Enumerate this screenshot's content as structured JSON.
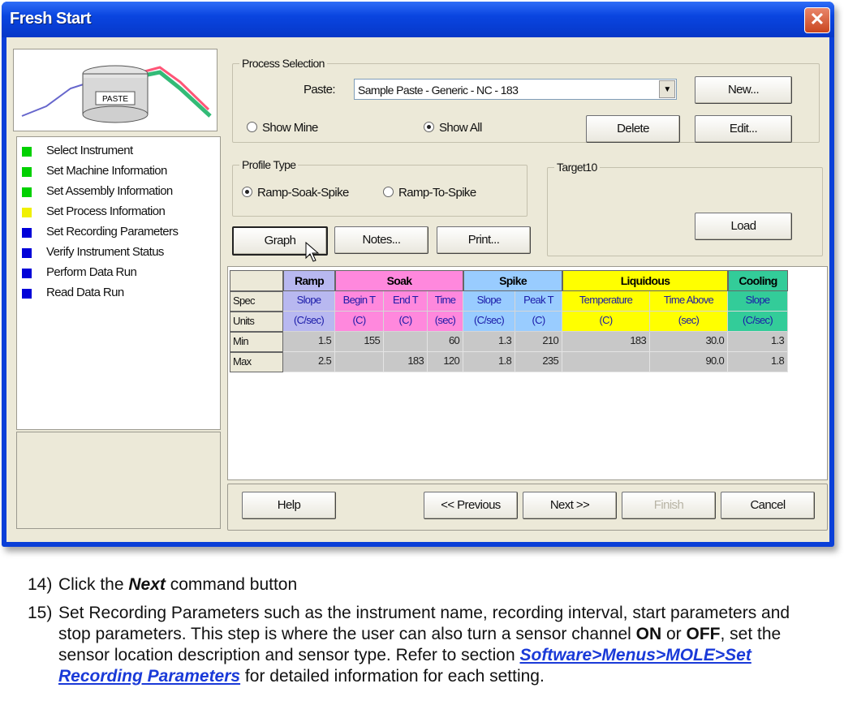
{
  "window": {
    "title": "Fresh Start",
    "close": "✕"
  },
  "image": {
    "jar_label": "PASTE"
  },
  "steps": [
    {
      "label": "Select Instrument",
      "color": "#00d000"
    },
    {
      "label": "Set Machine Information",
      "color": "#00d000"
    },
    {
      "label": "Set Assembly Information",
      "color": "#00d000"
    },
    {
      "label": "Set Process Information",
      "color": "#f0f000"
    },
    {
      "label": "Set Recording Parameters",
      "color": "#0000d8"
    },
    {
      "label": "Verify Instrument Status",
      "color": "#0000d8"
    },
    {
      "label": "Perform Data Run",
      "color": "#0000d8"
    },
    {
      "label": "Read Data Run",
      "color": "#0000d8"
    }
  ],
  "process_selection": {
    "label": "Process Selection",
    "paste_label": "Paste:",
    "paste_value": "Sample Paste - Generic - NC - 183",
    "new_button": "New...",
    "show_mine": "Show Mine",
    "show_all": "Show All",
    "delete_button": "Delete",
    "edit_button": "Edit..."
  },
  "profile_type": {
    "label": "Profile Type",
    "option1": "Ramp-Soak-Spike",
    "option2": "Ramp-To-Spike"
  },
  "target": {
    "label": "Target10",
    "load_button": "Load"
  },
  "buttons": {
    "graph": "Graph",
    "notes": "Notes...",
    "print": "Print..."
  },
  "table": {
    "groups": [
      {
        "label": "Ramp",
        "color": "#b8b8f0"
      },
      {
        "label": "Soak",
        "color": "#ff88dd"
      },
      {
        "label": "Spike",
        "color": "#99ccff"
      },
      {
        "label": "Liquidous",
        "color": "#ffff00"
      },
      {
        "label": "Cooling",
        "color": "#33cc99"
      }
    ],
    "row_labels": [
      "Spec",
      "Units",
      "Min",
      "Max"
    ],
    "spec": [
      "Slope",
      "Begin T",
      "End T",
      "Time",
      "Slope",
      "Peak T",
      "Temperature",
      "Time Above",
      "Slope"
    ],
    "units": [
      "(C/sec)",
      "(C)",
      "(C)",
      "(sec)",
      "(C/sec)",
      "(C)",
      "(C)",
      "(sec)",
      "(C/sec)"
    ],
    "min": [
      "1.5",
      "155",
      "",
      "60",
      "1.3",
      "210",
      "183",
      "30.0",
      "1.3"
    ],
    "max": [
      "2.5",
      "",
      "183",
      "120",
      "1.8",
      "235",
      "",
      "90.0",
      "1.8"
    ]
  },
  "footer": {
    "help": "Help",
    "previous": "<< Previous",
    "next": "Next >>",
    "finish": "Finish",
    "cancel": "Cancel"
  },
  "instructions": {
    "i14_num": "14)",
    "i14_pre": "Click the ",
    "i14_bold": "Next",
    "i14_post": " command button",
    "i15_num": "15)",
    "i15_a": "Set Recording Parameters such as the instrument name, recording interval, start parameters and stop parameters. This step is where the user can also turn a sensor channel ",
    "i15_on": "ON",
    "i15_or": " or ",
    "i15_off": "OFF",
    "i15_b": ", set the sensor location description and sensor type. Refer to section ",
    "i15_link": "Software>Menus>MOLE>Set Recording Parameters",
    "i15_c": " for detailed information for each setting."
  }
}
